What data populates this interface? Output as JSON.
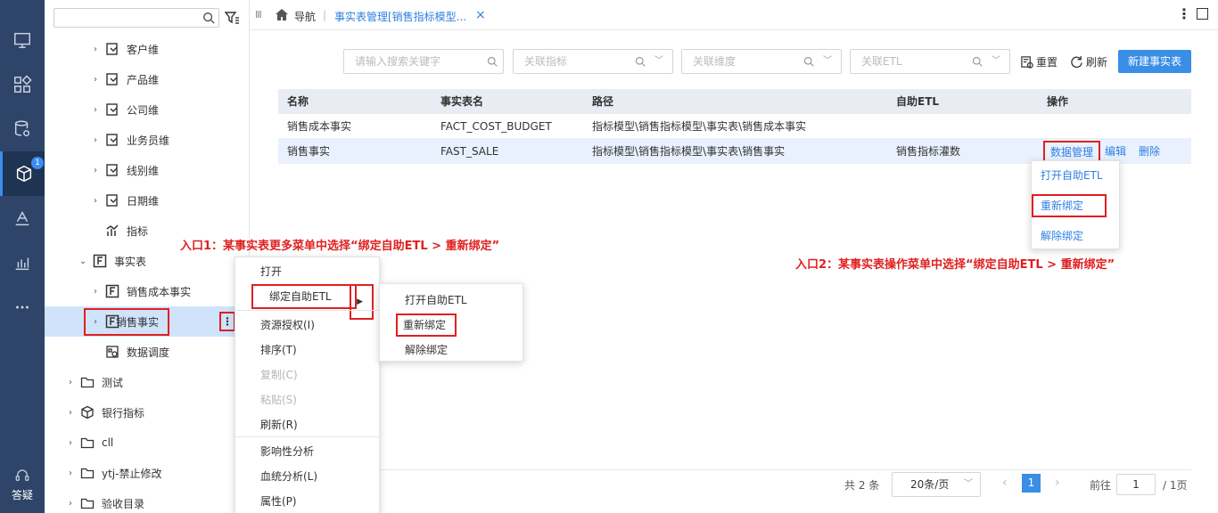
{
  "rail": {
    "badge": "1",
    "help_label": "答疑"
  },
  "tree": {
    "search_placeholder": "",
    "items": [
      {
        "label": "客户维"
      },
      {
        "label": "产品维"
      },
      {
        "label": "公司维"
      },
      {
        "label": "业务员维"
      },
      {
        "label": "线别维"
      },
      {
        "label": "日期维"
      },
      {
        "label": "指标"
      },
      {
        "label": "事实表"
      },
      {
        "label": "销售成本事实"
      },
      {
        "label": "销售事实"
      },
      {
        "label": "数据调度"
      },
      {
        "label": "测试"
      },
      {
        "label": "银行指标"
      },
      {
        "label": "cll"
      },
      {
        "label": "ytj-禁止修改"
      },
      {
        "label": "验收目录"
      }
    ],
    "more_glyph": "⋮"
  },
  "topbar": {
    "grip": "III",
    "nav": "导航",
    "sep": "|",
    "tab": "事实表管理[销售指标模型...",
    "close": "×"
  },
  "filters": {
    "search_placeholder": "请输入搜索关键字",
    "indicator_placeholder": "关联指标",
    "dimension_placeholder": "关联维度",
    "etl_placeholder": "关联ETL"
  },
  "actions": {
    "reset": "重置",
    "refresh": "刷新",
    "new": "新建事实表"
  },
  "table": {
    "headers": [
      "名称",
      "事实表名",
      "路径",
      "自助ETL",
      "操作"
    ],
    "rows": [
      {
        "name": "销售成本事实",
        "table": "FACT_COST_BUDGET",
        "path": "指标模型\\销售指标模型\\事实表\\销售成本事实",
        "etl": ""
      },
      {
        "name": "销售事实",
        "table": "FAST_SALE",
        "path": "指标模型\\销售指标模型\\事实表\\销售事实",
        "etl": "销售指标灌数",
        "ops": [
          "数据管理",
          "编辑",
          "删除"
        ]
      }
    ]
  },
  "op_menu": [
    "打开自助ETL",
    "重新绑定",
    "解除绑定"
  ],
  "context_menu": {
    "items": [
      "打开",
      "绑定自助ETL",
      "资源授权(I)",
      "排序(T)",
      "复制(C)",
      "粘贴(S)",
      "刷新(R)",
      "影响性分析",
      "血统分析(L)",
      "属性(P)"
    ],
    "submenu": [
      "打开自助ETL",
      "重新绑定",
      "解除绑定"
    ]
  },
  "pagination": {
    "total": "共 2 条",
    "page_size": "20条/页",
    "prev": "‹",
    "next": "›",
    "current": "1",
    "goto_label": "前往",
    "goto_value": "1",
    "total_pages": "/ 1页"
  },
  "annotations": {
    "entry1": "入口1：某事实表更多菜单中选择“绑定自助ETL > 重新绑定”",
    "entry2": "入口2：某事实表操作菜单中选择“绑定自助ETL > 重新绑定”"
  },
  "colors": {
    "rail": "#2e4468",
    "accent": "#3a8ee6",
    "annotation": "#e02020",
    "selected_row": "#cfe3fb"
  }
}
